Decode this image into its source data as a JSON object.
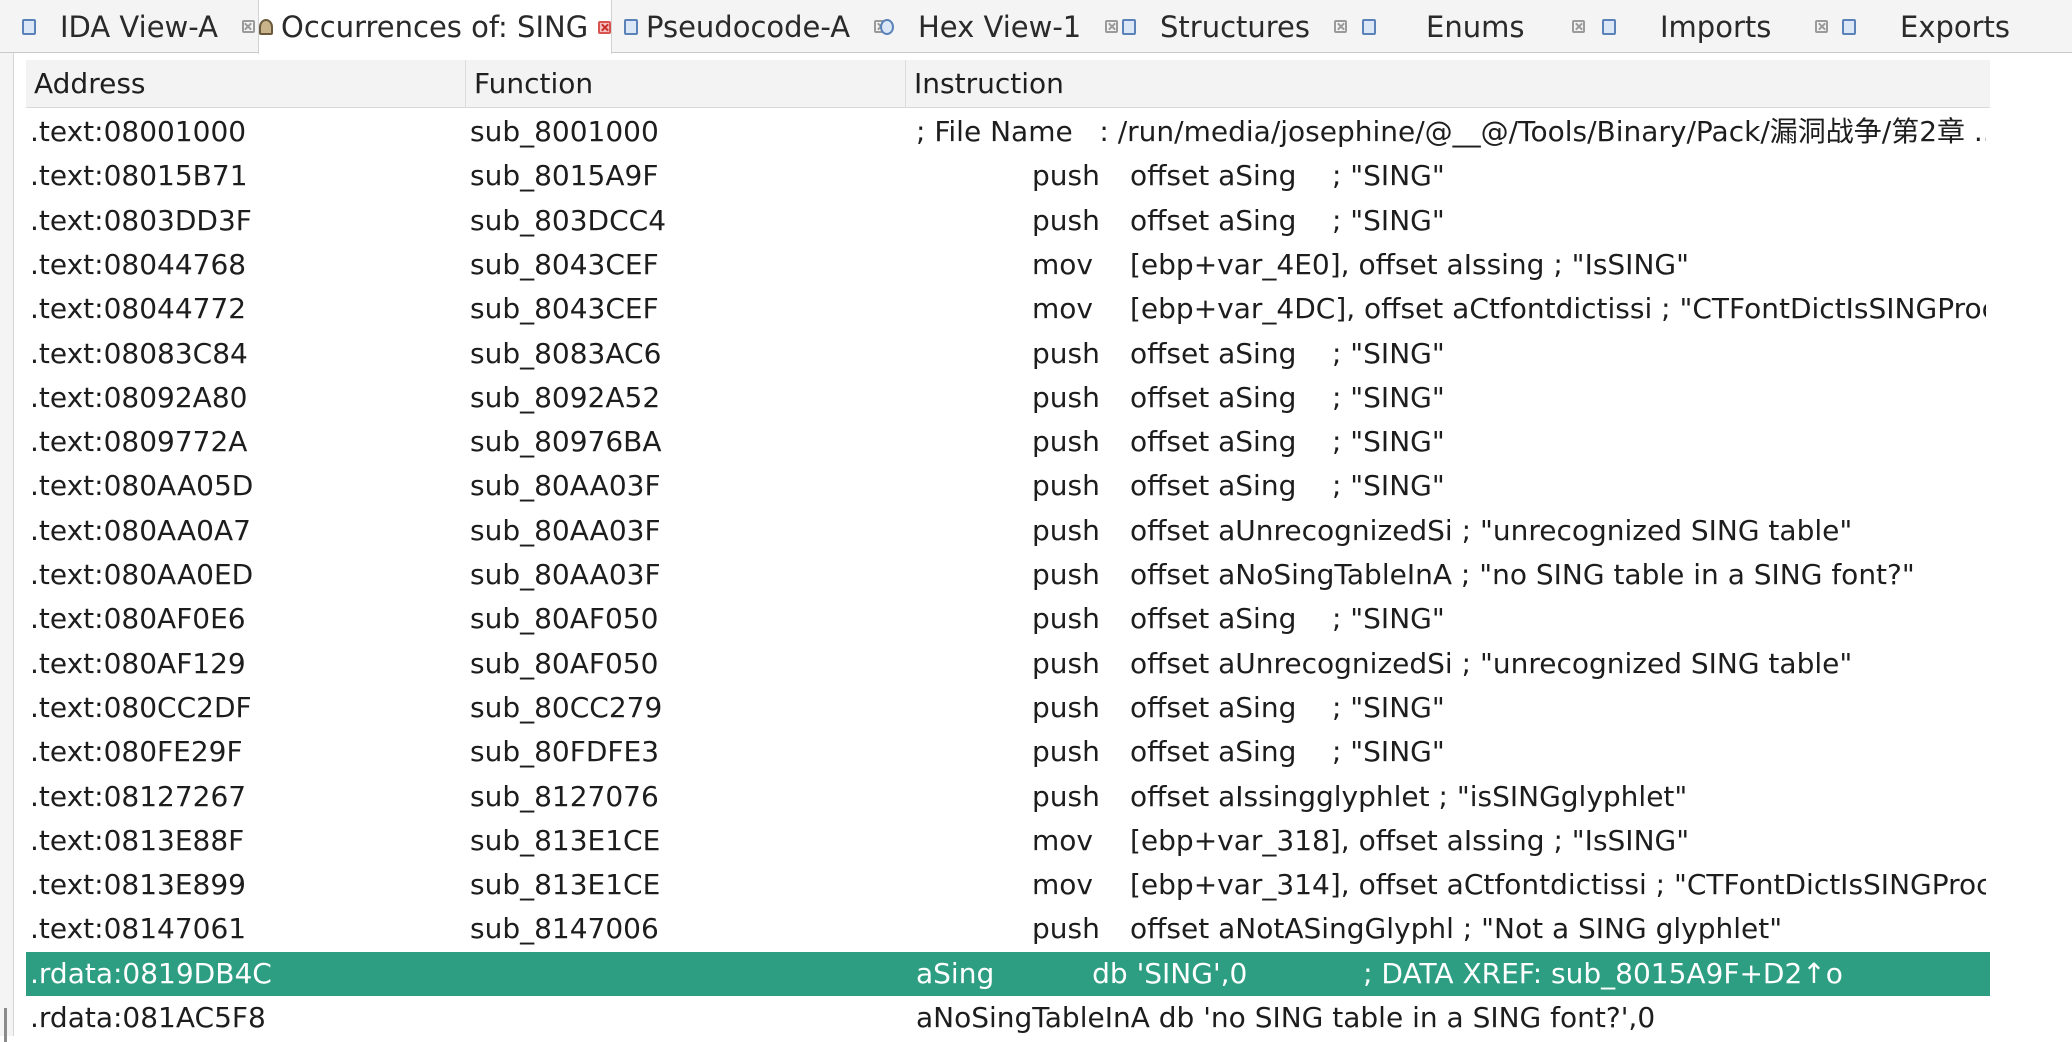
{
  "tabs": [
    {
      "label": "IDA View-A"
    },
    {
      "label": "Occurrences of: SING"
    },
    {
      "label": "Pseudocode-A"
    },
    {
      "label": "Hex View-1"
    },
    {
      "label": "Structures"
    },
    {
      "label": "Enums"
    },
    {
      "label": "Imports"
    },
    {
      "label": "Exports"
    }
  ],
  "columns": {
    "address": "Address",
    "function": "Function",
    "instruction": "Instruction"
  },
  "colors": {
    "selected_row": "#2e9e83"
  },
  "rows": [
    {
      "address": ".text:08001000",
      "function": "sub_8001000",
      "raw": "; File Name   : /run/media/josephine/@__@/Tools/Binary/Pack/漏洞战争/第2章 ..."
    },
    {
      "address": ".text:08015B71",
      "function": "sub_8015A9F",
      "mnemonic": "push",
      "operands": "offset aSing    ; \"SING\""
    },
    {
      "address": ".text:0803DD3F",
      "function": "sub_803DCC4",
      "mnemonic": "push",
      "operands": "offset aSing    ; \"SING\""
    },
    {
      "address": ".text:08044768",
      "function": "sub_8043CEF",
      "mnemonic": "mov",
      "operands": "[ebp+var_4E0], offset aIssing ; \"IsSING\""
    },
    {
      "address": ".text:08044772",
      "function": "sub_8043CEF",
      "mnemonic": "mov",
      "operands": "[ebp+var_4DC], offset aCtfontdictissi ; \"CTFontDictIsSINGProc\""
    },
    {
      "address": ".text:08083C84",
      "function": "sub_8083AC6",
      "mnemonic": "push",
      "operands": "offset aSing    ; \"SING\""
    },
    {
      "address": ".text:08092A80",
      "function": "sub_8092A52",
      "mnemonic": "push",
      "operands": "offset aSing    ; \"SING\""
    },
    {
      "address": ".text:0809772A",
      "function": "sub_80976BA",
      "mnemonic": "push",
      "operands": "offset aSing    ; \"SING\""
    },
    {
      "address": ".text:080AA05D",
      "function": "sub_80AA03F",
      "mnemonic": "push",
      "operands": "offset aSing    ; \"SING\""
    },
    {
      "address": ".text:080AA0A7",
      "function": "sub_80AA03F",
      "mnemonic": "push",
      "operands": "offset aUnrecognizedSi ; \"unrecognized SING table\""
    },
    {
      "address": ".text:080AA0ED",
      "function": "sub_80AA03F",
      "mnemonic": "push",
      "operands": "offset aNoSingTableInA ; \"no SING table in a SING font?\""
    },
    {
      "address": ".text:080AF0E6",
      "function": "sub_80AF050",
      "mnemonic": "push",
      "operands": "offset aSing    ; \"SING\""
    },
    {
      "address": ".text:080AF129",
      "function": "sub_80AF050",
      "mnemonic": "push",
      "operands": "offset aUnrecognizedSi ; \"unrecognized SING table\""
    },
    {
      "address": ".text:080CC2DF",
      "function": "sub_80CC279",
      "mnemonic": "push",
      "operands": "offset aSing    ; \"SING\""
    },
    {
      "address": ".text:080FE29F",
      "function": "sub_80FDFE3",
      "mnemonic": "push",
      "operands": "offset aSing    ; \"SING\""
    },
    {
      "address": ".text:08127267",
      "function": "sub_8127076",
      "mnemonic": "push",
      "operands": "offset aIssingglyphlet ; \"isSINGglyphlet\""
    },
    {
      "address": ".text:0813E88F",
      "function": "sub_813E1CE",
      "mnemonic": "mov",
      "operands": "[ebp+var_318], offset aIssing ; \"IsSING\""
    },
    {
      "address": ".text:0813E899",
      "function": "sub_813E1CE",
      "mnemonic": "mov",
      "operands": "[ebp+var_314], offset aCtfontdictissi ; \"CTFontDictIsSINGProc\""
    },
    {
      "address": ".text:08147061",
      "function": "sub_8147006",
      "mnemonic": "push",
      "operands": "offset aNotASingGlyphl ; \"Not a SING glyphlet\""
    },
    {
      "address": ".rdata:0819DB4C",
      "function": "",
      "raw": "aSing           db 'SING',0             ; DATA XREF: sub_8015A9F+D2↑o",
      "selected": true
    },
    {
      "address": ".rdata:081AC5F8",
      "function": "",
      "raw": "aNoSingTableInA db 'no SING table in a SING font?',0"
    }
  ]
}
